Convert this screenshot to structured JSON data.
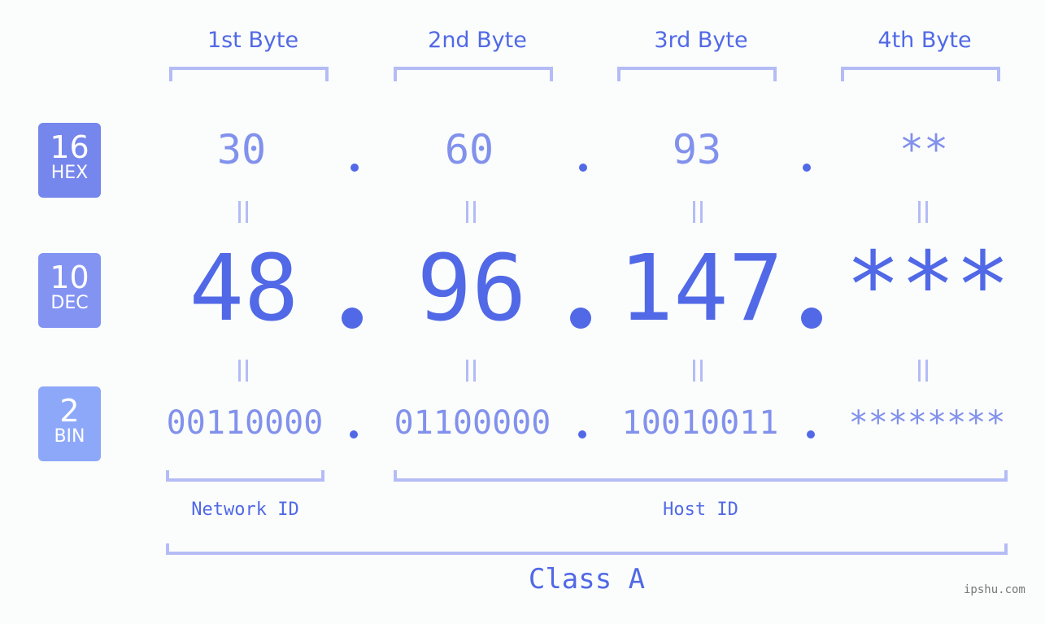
{
  "bytes": {
    "labels": [
      "1st Byte",
      "2nd Byte",
      "3rd Byte",
      "4th Byte"
    ]
  },
  "badges": {
    "hex": {
      "num": "16",
      "label": "HEX",
      "color": "#7586ec"
    },
    "dec": {
      "num": "10",
      "label": "DEC",
      "color": "#8393f2"
    },
    "bin": {
      "num": "2",
      "label": "BIN",
      "color": "#8ea8f9"
    }
  },
  "values": {
    "hex": [
      "30",
      "60",
      "93",
      "**"
    ],
    "dec": [
      "48",
      "96",
      "147",
      "***"
    ],
    "bin": [
      "00110000",
      "01100000",
      "10010011",
      "********"
    ]
  },
  "segments": {
    "network_id": "Network ID",
    "host_id": "Host ID",
    "class": "Class A"
  },
  "watermark": "ipshu.com",
  "colors": {
    "accent": "#5169e6",
    "light_accent": "#8191ec",
    "bracket": "#b4bcf6",
    "background": "#fbfdfc"
  }
}
